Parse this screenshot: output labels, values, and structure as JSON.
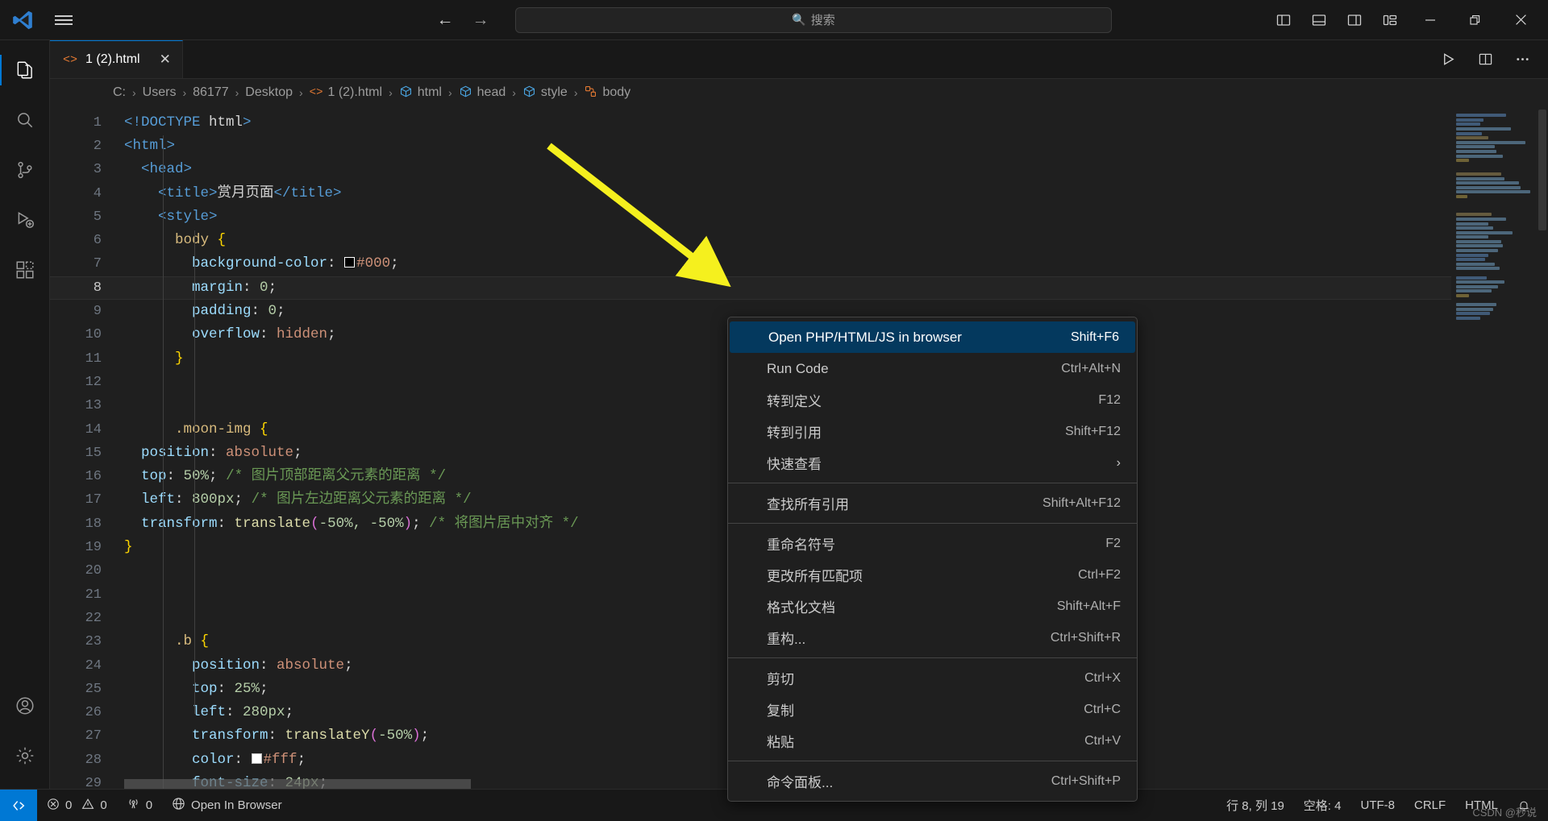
{
  "titlebar": {
    "logo_icon": "vscode-logo-icon",
    "menu_icon": "hamburger-menu-icon",
    "back_icon": "arrow-left-icon",
    "forward_icon": "arrow-right-icon",
    "search_placeholder": "搜索",
    "search_value": "搜索",
    "search_icon": "search-icon",
    "layout_icons": [
      "toggle-primary-sidebar-icon",
      "toggle-panel-icon",
      "toggle-secondary-sidebar-icon",
      "customize-layout-icon"
    ],
    "window_minimize": "−",
    "window_restore": "restore-icon",
    "window_close": "✕"
  },
  "activitybar": {
    "items": [
      {
        "name": "explorer",
        "icon": "files-icon",
        "active": true
      },
      {
        "name": "search",
        "icon": "search-icon",
        "active": false
      },
      {
        "name": "source-control",
        "icon": "source-control-icon",
        "active": false
      },
      {
        "name": "run-and-debug",
        "icon": "run-debug-icon",
        "active": false
      },
      {
        "name": "extensions",
        "icon": "extensions-icon",
        "active": false
      }
    ],
    "bottom_items": [
      {
        "name": "accounts",
        "icon": "account-icon"
      },
      {
        "name": "settings",
        "icon": "gear-icon"
      }
    ]
  },
  "tabs": [
    {
      "label": "1 (2).html",
      "icon": "html-file-icon",
      "close_icon": "close-icon",
      "active": true
    }
  ],
  "editor_actions": [
    {
      "name": "run-code",
      "icon": "play-icon"
    },
    {
      "name": "split-editor",
      "icon": "split-editor-icon"
    },
    {
      "name": "more-actions",
      "icon": "ellipsis-icon"
    }
  ],
  "breadcrumbs": [
    {
      "label": "C:",
      "icon": ""
    },
    {
      "label": "Users",
      "icon": ""
    },
    {
      "label": "86177",
      "icon": ""
    },
    {
      "label": "Desktop",
      "icon": ""
    },
    {
      "label": "1 (2).html",
      "icon": "html-file-icon"
    },
    {
      "label": "html",
      "icon": "symbol-cube-icon"
    },
    {
      "label": "head",
      "icon": "symbol-cube-icon"
    },
    {
      "label": "style",
      "icon": "symbol-cube-icon"
    },
    {
      "label": "body",
      "icon": "symbol-ruler-icon"
    }
  ],
  "editor": {
    "current_line": 8,
    "lines": [
      {
        "n": "1",
        "segments": [
          {
            "t": "<!DOCTYPE ",
            "c": "t-tag"
          },
          {
            "t": "html",
            "c": "t-plain"
          },
          {
            "t": ">",
            "c": "t-tag"
          }
        ]
      },
      {
        "n": "2",
        "segments": [
          {
            "t": "<html>",
            "c": "t-tag"
          }
        ]
      },
      {
        "n": "3",
        "segments": [
          {
            "t": "  <head>",
            "c": "t-tag"
          }
        ]
      },
      {
        "n": "4",
        "segments": [
          {
            "t": "    <title>",
            "c": "t-tag"
          },
          {
            "t": "赏月页面",
            "c": "t-plain"
          },
          {
            "t": "</title>",
            "c": "t-tag"
          }
        ]
      },
      {
        "n": "5",
        "segments": [
          {
            "t": "    <style>",
            "c": "t-tag"
          }
        ]
      },
      {
        "n": "6",
        "segments": [
          {
            "t": "      body ",
            "c": "t-sel"
          },
          {
            "t": "{",
            "c": "t-brace"
          }
        ]
      },
      {
        "n": "7",
        "segments": [
          {
            "t": "        background-color",
            "c": "t-prop"
          },
          {
            "t": ": ",
            "c": "t-plain"
          },
          {
            "t": "__SWATCH_BLACK__",
            "c": "swatch"
          },
          {
            "t": "#000",
            "c": "t-val"
          },
          {
            "t": ";",
            "c": "t-plain"
          }
        ]
      },
      {
        "n": "8",
        "segments": [
          {
            "t": "        margin",
            "c": "t-prop"
          },
          {
            "t": ": ",
            "c": "t-plain"
          },
          {
            "t": "0",
            "c": "t-num"
          },
          {
            "t": ";",
            "c": "t-plain"
          }
        ]
      },
      {
        "n": "9",
        "segments": [
          {
            "t": "        padding",
            "c": "t-prop"
          },
          {
            "t": ": ",
            "c": "t-plain"
          },
          {
            "t": "0",
            "c": "t-num"
          },
          {
            "t": ";",
            "c": "t-plain"
          }
        ]
      },
      {
        "n": "10",
        "segments": [
          {
            "t": "        overflow",
            "c": "t-prop"
          },
          {
            "t": ": ",
            "c": "t-plain"
          },
          {
            "t": "hidden",
            "c": "t-val"
          },
          {
            "t": ";",
            "c": "t-plain"
          }
        ]
      },
      {
        "n": "11",
        "segments": [
          {
            "t": "      }",
            "c": "t-brace"
          }
        ]
      },
      {
        "n": "12",
        "segments": []
      },
      {
        "n": "13",
        "segments": []
      },
      {
        "n": "14",
        "segments": [
          {
            "t": "      .moon-img ",
            "c": "t-sel"
          },
          {
            "t": "{",
            "c": "t-brace"
          }
        ]
      },
      {
        "n": "15",
        "segments": [
          {
            "t": "  position",
            "c": "t-prop"
          },
          {
            "t": ": ",
            "c": "t-plain"
          },
          {
            "t": "absolute",
            "c": "t-val"
          },
          {
            "t": ";",
            "c": "t-plain"
          }
        ]
      },
      {
        "n": "16",
        "segments": [
          {
            "t": "  top",
            "c": "t-prop"
          },
          {
            "t": ": ",
            "c": "t-plain"
          },
          {
            "t": "50%",
            "c": "t-num"
          },
          {
            "t": "; ",
            "c": "t-plain"
          },
          {
            "t": "/* 图片顶部距离父元素的距离 */",
            "c": "t-comment"
          }
        ]
      },
      {
        "n": "17",
        "segments": [
          {
            "t": "  left",
            "c": "t-prop"
          },
          {
            "t": ": ",
            "c": "t-plain"
          },
          {
            "t": "800px",
            "c": "t-num"
          },
          {
            "t": "; ",
            "c": "t-plain"
          },
          {
            "t": "/* 图片左边距离父元素的距离 */",
            "c": "t-comment"
          }
        ]
      },
      {
        "n": "18",
        "segments": [
          {
            "t": "  transform",
            "c": "t-prop"
          },
          {
            "t": ": ",
            "c": "t-plain"
          },
          {
            "t": "translate",
            "c": "t-fn"
          },
          {
            "t": "(",
            "c": "t-brace2"
          },
          {
            "t": "-50%, -50%",
            "c": "t-num"
          },
          {
            "t": ")",
            "c": "t-brace2"
          },
          {
            "t": "; ",
            "c": "t-plain"
          },
          {
            "t": "/* 将图片居中对齐 */",
            "c": "t-comment"
          }
        ]
      },
      {
        "n": "19",
        "segments": [
          {
            "t": "}",
            "c": "t-brace"
          }
        ]
      },
      {
        "n": "20",
        "segments": []
      },
      {
        "n": "21",
        "segments": []
      },
      {
        "n": "22",
        "segments": []
      },
      {
        "n": "23",
        "segments": [
          {
            "t": "      .b ",
            "c": "t-sel"
          },
          {
            "t": "{",
            "c": "t-brace"
          }
        ]
      },
      {
        "n": "24",
        "segments": [
          {
            "t": "        position",
            "c": "t-prop"
          },
          {
            "t": ": ",
            "c": "t-plain"
          },
          {
            "t": "absolute",
            "c": "t-val"
          },
          {
            "t": ";",
            "c": "t-plain"
          }
        ]
      },
      {
        "n": "25",
        "segments": [
          {
            "t": "        top",
            "c": "t-prop"
          },
          {
            "t": ": ",
            "c": "t-plain"
          },
          {
            "t": "25%",
            "c": "t-num"
          },
          {
            "t": ";",
            "c": "t-plain"
          }
        ]
      },
      {
        "n": "26",
        "segments": [
          {
            "t": "        left",
            "c": "t-prop"
          },
          {
            "t": ": ",
            "c": "t-plain"
          },
          {
            "t": "280px",
            "c": "t-num"
          },
          {
            "t": ";",
            "c": "t-plain"
          }
        ]
      },
      {
        "n": "27",
        "segments": [
          {
            "t": "        transform",
            "c": "t-prop"
          },
          {
            "t": ": ",
            "c": "t-plain"
          },
          {
            "t": "translateY",
            "c": "t-fn"
          },
          {
            "t": "(",
            "c": "t-brace2"
          },
          {
            "t": "-50%",
            "c": "t-num"
          },
          {
            "t": ")",
            "c": "t-brace2"
          },
          {
            "t": ";",
            "c": "t-plain"
          }
        ]
      },
      {
        "n": "28",
        "segments": [
          {
            "t": "        color",
            "c": "t-prop"
          },
          {
            "t": ": ",
            "c": "t-plain"
          },
          {
            "t": "__SWATCH_WHITE__",
            "c": "swatch white"
          },
          {
            "t": "#fff",
            "c": "t-val"
          },
          {
            "t": ";",
            "c": "t-plain"
          }
        ]
      },
      {
        "n": "29",
        "segments": [
          {
            "t": "        font-size",
            "c": "t-prop"
          },
          {
            "t": ": ",
            "c": "t-plain"
          },
          {
            "t": "24px",
            "c": "t-num"
          },
          {
            "t": ";",
            "c": "t-plain"
          }
        ]
      }
    ]
  },
  "context_menu": {
    "groups": [
      [
        {
          "label": "Open PHP/HTML/JS in browser",
          "key": "Shift+F6",
          "selected": true
        },
        {
          "label": "Run Code",
          "key": "Ctrl+Alt+N",
          "selected": false
        },
        {
          "label": "转到定义",
          "key": "F12",
          "selected": false
        },
        {
          "label": "转到引用",
          "key": "Shift+F12",
          "selected": false
        },
        {
          "label": "快速查看",
          "key": "",
          "submenu": true,
          "selected": false
        }
      ],
      [
        {
          "label": "查找所有引用",
          "key": "Shift+Alt+F12",
          "selected": false
        }
      ],
      [
        {
          "label": "重命名符号",
          "key": "F2",
          "selected": false
        },
        {
          "label": "更改所有匹配项",
          "key": "Ctrl+F2",
          "selected": false
        },
        {
          "label": "格式化文档",
          "key": "Shift+Alt+F",
          "selected": false
        },
        {
          "label": "重构...",
          "key": "Ctrl+Shift+R",
          "selected": false
        }
      ],
      [
        {
          "label": "剪切",
          "key": "Ctrl+X",
          "selected": false
        },
        {
          "label": "复制",
          "key": "Ctrl+C",
          "selected": false
        },
        {
          "label": "粘贴",
          "key": "Ctrl+V",
          "selected": false
        }
      ],
      [
        {
          "label": "命令面板...",
          "key": "Ctrl+Shift+P",
          "selected": false
        }
      ]
    ],
    "submenu_chevron": "›"
  },
  "statusbar": {
    "remote_icon": "remote-window-icon",
    "errors": "0",
    "warnings": "0",
    "ports": "0",
    "error_icon": "error-circle-icon",
    "warning_icon": "warning-triangle-icon",
    "ports_icon": "radio-tower-icon",
    "open_in_browser": "Open In Browser",
    "globe_icon": "globe-icon",
    "cursor_position": "行 8, 列 19",
    "indentation": "空格: 4",
    "encoding": "UTF-8",
    "eol": "CRLF",
    "language": "HTML",
    "bell_icon": "bell-icon",
    "watermark": "CSDN @秒说"
  },
  "annotation": {
    "arrow_color": "#f5f01e",
    "name": "yellow-pointer-arrow"
  }
}
